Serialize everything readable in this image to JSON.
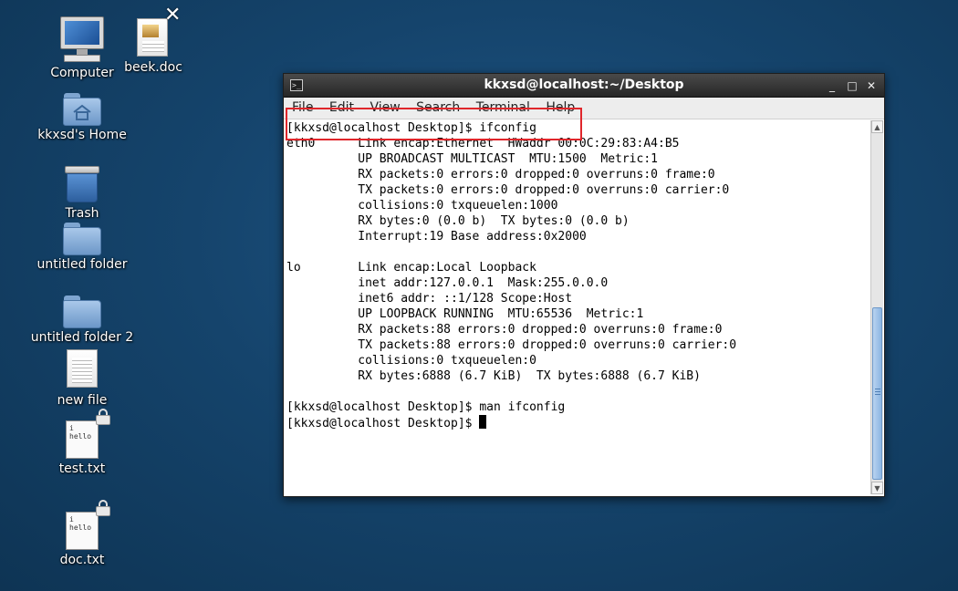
{
  "desktop": {
    "icons": [
      {
        "label": "Computer"
      },
      {
        "label": "beek.doc"
      },
      {
        "label": "kkxsd's Home"
      },
      {
        "label": "Trash"
      },
      {
        "label": "untitled folder"
      },
      {
        "label": "untitled folder 2"
      },
      {
        "label": "new file"
      },
      {
        "label": "test.txt",
        "preview": "i\nhello"
      },
      {
        "label": "doc.txt",
        "preview": "i\nhello"
      }
    ]
  },
  "window": {
    "title": "kkxsd@localhost:~/Desktop",
    "controls": {
      "minimize": "_",
      "maximize": "□",
      "close": "✕"
    },
    "icon_glyph": ">_",
    "menu": [
      "File",
      "Edit",
      "View",
      "Search",
      "Terminal",
      "Help"
    ]
  },
  "terminal": {
    "lines": [
      "[kkxsd@localhost Desktop]$ ifconfig",
      "eth0      Link encap:Ethernet  HWaddr 00:0C:29:83:A4:B5",
      "          UP BROADCAST MULTICAST  MTU:1500  Metric:1",
      "          RX packets:0 errors:0 dropped:0 overruns:0 frame:0",
      "          TX packets:0 errors:0 dropped:0 overruns:0 carrier:0",
      "          collisions:0 txqueuelen:1000",
      "          RX bytes:0 (0.0 b)  TX bytes:0 (0.0 b)",
      "          Interrupt:19 Base address:0x2000",
      "",
      "lo        Link encap:Local Loopback",
      "          inet addr:127.0.0.1  Mask:255.0.0.0",
      "          inet6 addr: ::1/128 Scope:Host",
      "          UP LOOPBACK RUNNING  MTU:65536  Metric:1",
      "          RX packets:88 errors:0 dropped:0 overruns:0 frame:0",
      "          TX packets:88 errors:0 dropped:0 overruns:0 carrier:0",
      "          collisions:0 txqueuelen:0",
      "          RX bytes:6888 (6.7 KiB)  TX bytes:6888 (6.7 KiB)",
      "",
      "[kkxsd@localhost Desktop]$ man ifconfig",
      "[kkxsd@localhost Desktop]$ "
    ]
  },
  "colors": {
    "highlight": "#e0262b",
    "desktop_bg": "#15446c",
    "titlebar": "#2f2f2f"
  }
}
